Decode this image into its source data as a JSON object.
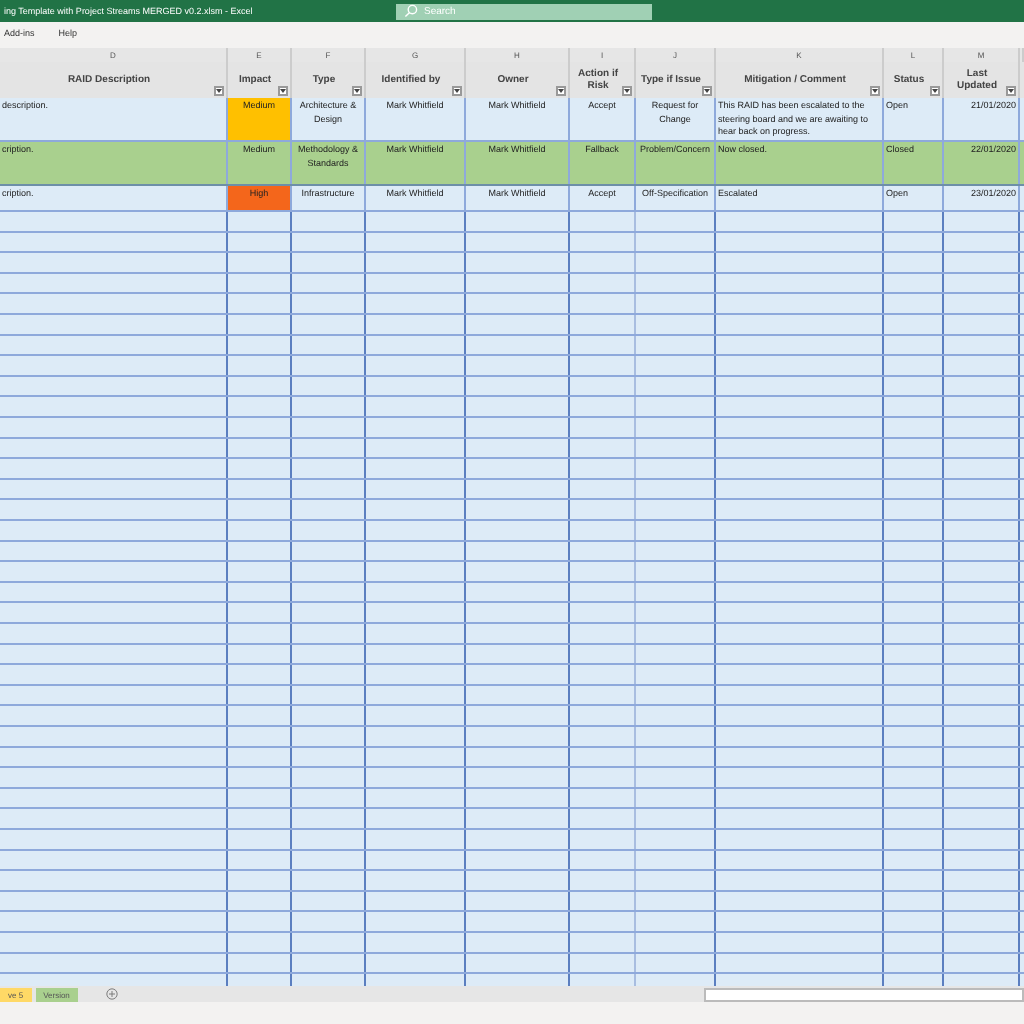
{
  "window": {
    "title": "ing Template with Project Streams MERGED v0.2.xlsm  -  Excel",
    "search_placeholder": "Search"
  },
  "menu": [
    "Add-ins",
    "Help"
  ],
  "column_letters": [
    "D",
    "E",
    "F",
    "G",
    "H",
    "I",
    "J",
    "K",
    "L",
    "M"
  ],
  "columns": [
    {
      "label": "RAID Description",
      "filter": true
    },
    {
      "label": "Impact",
      "filter": true
    },
    {
      "label": "Type",
      "filter": true
    },
    {
      "label": "Identified by",
      "filter": true
    },
    {
      "label": "Owner",
      "filter": true
    },
    {
      "label": "Action if Risk",
      "filter": true
    },
    {
      "label": "Type if Issue",
      "filter": true
    },
    {
      "label": "Mitigation / Comment",
      "filter": true
    },
    {
      "label": "Status",
      "filter": true
    },
    {
      "label": "Last Updated",
      "filter": true
    }
  ],
  "rows": [
    {
      "highlighted": false,
      "color": "#ffc000",
      "cells": [
        "description.",
        "Medium",
        "Architecture & Design",
        "Mark Whitfield",
        "Mark Whitfield",
        "Accept",
        "Request for Change",
        "This RAID has been escalated to the steering board and we are awaiting to hear back on progress.",
        "Open",
        "21/01/2020"
      ]
    },
    {
      "highlighted": true,
      "color": "#a9d08e",
      "cells": [
        "cription.",
        "Medium",
        "Methodology & Standards",
        "Mark Whitfield",
        "Mark Whitfield",
        "Fallback",
        "Problem/Concern",
        "Now closed.",
        "Closed",
        "22/01/2020"
      ]
    },
    {
      "highlighted": false,
      "color": "#f4661b",
      "cells": [
        "cription.",
        "High",
        "Infrastructure",
        "Mark Whitfield",
        "Mark Whitfield",
        "Accept",
        "Off-Specification",
        "Escalated",
        "Open",
        "23/01/2020"
      ]
    }
  ],
  "sheet_tabs": [
    {
      "label": "ve 5",
      "color": "#ffd966",
      "selected": false
    },
    {
      "label": "Version",
      "color": "#a9d08e",
      "selected": false
    }
  ]
}
